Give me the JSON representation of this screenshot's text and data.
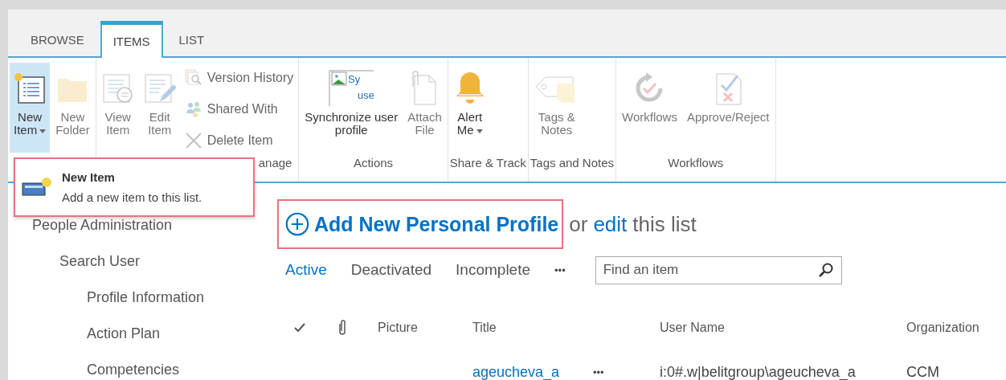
{
  "tabs": [
    {
      "label": "BROWSE",
      "selected": false
    },
    {
      "label": "ITEMS",
      "selected": true
    },
    {
      "label": "LIST",
      "selected": false
    }
  ],
  "ribbon": {
    "groups": [
      {
        "buttons": [
          {
            "kind": "large",
            "label": "New\nItem",
            "dropdown": true,
            "active": true,
            "disabled": false
          },
          {
            "kind": "large",
            "label": "New\nFolder",
            "dropdown": false,
            "active": false,
            "disabled": true
          }
        ]
      },
      {
        "label": "anage",
        "buttons": [
          {
            "kind": "large",
            "label": "View\nItem",
            "dropdown": false,
            "active": false,
            "disabled": true
          },
          {
            "kind": "large",
            "label": "Edit\nItem",
            "dropdown": false,
            "active": false,
            "disabled": true
          },
          {
            "kind": "small",
            "label": "Version History",
            "disabled": true
          },
          {
            "kind": "small",
            "label": "Shared With",
            "disabled": true
          },
          {
            "kind": "small",
            "label": "Delete Item",
            "disabled": true
          }
        ]
      },
      {
        "label": "Actions",
        "buttons": [
          {
            "kind": "large",
            "icon_text": [
              "Sy",
              "use"
            ],
            "label": "Synchronize user\nprofile",
            "dropdown": false,
            "active": false,
            "disabled": false
          },
          {
            "kind": "large",
            "label": "Attach\nFile",
            "dropdown": false,
            "active": false,
            "disabled": true
          }
        ]
      },
      {
        "label": "Share & Track",
        "buttons": [
          {
            "kind": "large",
            "label": "Alert\nMe",
            "dropdown": true,
            "active": false,
            "disabled": false
          }
        ]
      },
      {
        "label": "Tags and Notes",
        "buttons": [
          {
            "kind": "large",
            "label": "Tags &\nNotes",
            "dropdown": false,
            "active": false,
            "disabled": true
          }
        ]
      },
      {
        "label": "Workflows",
        "buttons": [
          {
            "kind": "large",
            "label": "Workflows",
            "dropdown": false,
            "active": false,
            "disabled": true
          },
          {
            "kind": "large",
            "label": "Approve/Reject",
            "dropdown": false,
            "active": false,
            "disabled": true
          }
        ]
      }
    ]
  },
  "dropdown_menu": {
    "highlighted": true,
    "items": [
      {
        "title": "New Item",
        "description": "Add a new item to this list."
      }
    ]
  },
  "navigation": [
    {
      "label": "People Administration",
      "children": [
        {
          "label": "Search User",
          "children": [
            {
              "label": "Profile Information"
            },
            {
              "label": "Action Plan"
            },
            {
              "label": "Competencies"
            }
          ]
        }
      ]
    }
  ],
  "heading": {
    "add_link": "Add New Personal Profile",
    "highlighted": true,
    "or": "or",
    "edit_link": "edit",
    "rest": "this list"
  },
  "views": [
    {
      "label": "Active",
      "selected": true
    },
    {
      "label": "Deactivated",
      "selected": false
    },
    {
      "label": "Incomplete",
      "selected": false
    }
  ],
  "views_more": "•••",
  "search": {
    "placeholder": "Find an item"
  },
  "table": {
    "columns": [
      "Picture",
      "Title",
      "User Name",
      "Organization"
    ],
    "rows": [
      {
        "title": "ageucheva_a",
        "more": "•••",
        "user_name": "i:0#.w|belitgroup\\ageucheva_a",
        "organization": "CCM"
      }
    ]
  }
}
